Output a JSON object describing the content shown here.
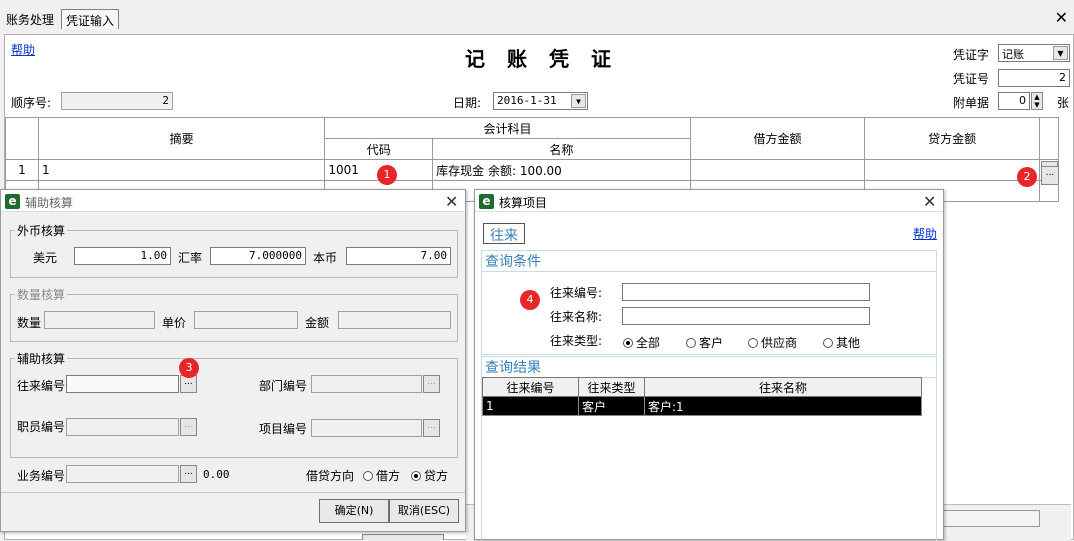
{
  "tabs": [
    "账务处理",
    "凭证输入"
  ],
  "voucher": {
    "help": "帮助",
    "title": "记账凭证",
    "seq_label": "顺序号:",
    "seq_value": "2",
    "date_label": "日期:",
    "date_value": "2016-1-31",
    "type_label": "凭证字",
    "type_value": "记账",
    "no_label": "凭证号",
    "no_value": "2",
    "attach_label": "附单据",
    "attach_value": "0",
    "attach_unit": "张",
    "headers": {
      "summary": "摘要",
      "account": "会计科目",
      "code": "代码",
      "name": "名称",
      "debit": "借方金额",
      "credit": "贷方金额"
    },
    "row": {
      "index": "1",
      "summary": "1",
      "code": "1001",
      "name": "库存现金 余额: 100.00",
      "ellipsis": "..."
    }
  },
  "badges": [
    "1",
    "2",
    "3",
    "4"
  ],
  "aux": {
    "title": "辅助核算",
    "fx_group": "外币核算",
    "usd_label": "美元",
    "usd_value": "1.00",
    "rate_label": "汇率",
    "rate_value": "7.000000",
    "local_label": "本币",
    "local_value": "7.00",
    "qty_group": "数量核算",
    "qty_label": "数量",
    "price_label": "单价",
    "amount_label": "金额",
    "assist_group": "辅助核算",
    "party_label": "往来编号",
    "dept_label": "部门编号",
    "staff_label": "职员编号",
    "project_label": "项目编号",
    "biz_label": "业务编号",
    "biz_amount": "0.00",
    "direction_label": "借贷方向",
    "debit": "借方",
    "credit": "贷方",
    "ok": "确定(N)",
    "cancel": "取消(ESC)"
  },
  "lookup": {
    "title": "核算项目",
    "tab": "往来",
    "help": "帮助",
    "query_head": "查询条件",
    "code_label": "往来编号:",
    "name_label": "往来名称:",
    "type_label": "往来类型:",
    "types": [
      "全部",
      "客户",
      "供应商",
      "其他"
    ],
    "result_head": "查询结果",
    "columns": [
      "往来编号",
      "往来类型",
      "往来名称"
    ],
    "rows": [
      {
        "code": "1",
        "type": "客户",
        "name": "客户:1"
      }
    ]
  }
}
